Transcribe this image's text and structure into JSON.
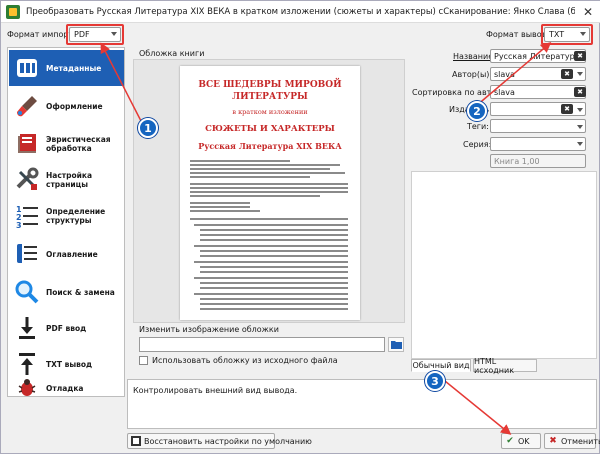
{
  "window": {
    "title": "Преобразовать Русская Литература XIX ВЕКА в кратком изложении (сюжеты и характеры) сСканирование: Янко Слава (библиотека Fort/Da)",
    "close_glyph": "✕"
  },
  "input_format": {
    "label": "Формат импорта:",
    "value": "PDF"
  },
  "output_format": {
    "label": "Формат вывода:",
    "value": "TXT"
  },
  "sidebar": {
    "items": [
      {
        "label": "Метаданные",
        "icon": "metadata-icon",
        "active": true
      },
      {
        "label": "Оформление",
        "icon": "brush-icon"
      },
      {
        "label": "Эвристическая обработка",
        "icon": "book-icon"
      },
      {
        "label": "Настройка страницы",
        "icon": "tools-icon"
      },
      {
        "label": "Определение структуры",
        "icon": "structure-icon"
      },
      {
        "label": "Оглавление",
        "icon": "toc-icon"
      },
      {
        "label": "Поиск & замена",
        "icon": "search-icon"
      },
      {
        "label": "PDF ввод",
        "icon": "pdf-arrow-icon"
      },
      {
        "label": "TXT вывод",
        "icon": "txt-arrow-icon"
      },
      {
        "label": "Отладка",
        "icon": "bug-icon"
      }
    ]
  },
  "cover": {
    "heading": "Обложка книги",
    "book_title_1": "ВСЕ ШЕДЕВРЫ МИРОВОЙ",
    "book_title_2": "ЛИТЕРАТУРЫ",
    "book_sub": "в кратком изложении",
    "book_title_3": "СЮЖЕТЫ И ХАРАКТЕРЫ",
    "book_title_4": "Русская Литература XIX ВЕКА",
    "change_label": "Изменить изображение обложки",
    "use_source_label": "Использовать обложку из исходного файла"
  },
  "form": {
    "title_label": "Название:",
    "title_value": "Русская Литература XIX В",
    "author_label": "Автор(ы):",
    "author_value": "slava",
    "sort_label": "Сортировка по автору",
    "sort_value": "slava",
    "publisher_label": "Издатель:",
    "tags_label": "Теги:",
    "series_label": "Серия:",
    "book_number": "Книга 1,00"
  },
  "tabs": {
    "normal": "Обычный вид",
    "html": "HTML исходник"
  },
  "description": "Контролировать внешний вид вывода.",
  "buttons": {
    "restore": "Восстановить настройки по умолчанию",
    "ok": "OK",
    "cancel": "Отменить"
  },
  "badges": {
    "one": "1",
    "two": "2",
    "three": "3"
  },
  "colors": {
    "accent": "#1e5fb4",
    "highlight": "#e53935",
    "badge": "#1565c0"
  }
}
